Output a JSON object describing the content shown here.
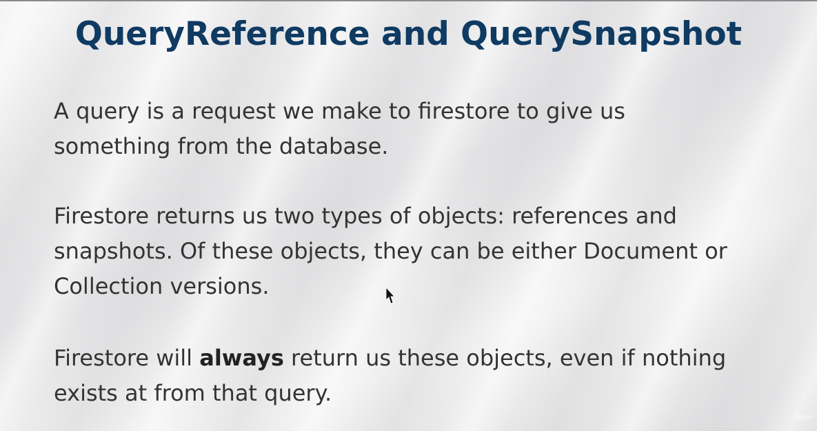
{
  "slide": {
    "title": "QueryReference and QuerySnapshot",
    "paragraph1": {
      "line1": "A query is a request we make to firestore to give us",
      "line2": "something from the database."
    },
    "paragraph2": {
      "line1": "Firestore returns us two types of objects: references and",
      "line2": "snapshots. Of these objects, they can be either Document or",
      "line3": "Collection versions."
    },
    "paragraph3": {
      "line1_pre": "Firestore will ",
      "line1_bold": "always",
      "line1_post": " return us these objects, even if nothing",
      "line2": "exists at from that query."
    },
    "watermark": "Udem"
  },
  "colors": {
    "title": "#0f3a62",
    "body_text": "#333333"
  },
  "icons": {
    "pointer": "mouse-pointer-icon"
  }
}
